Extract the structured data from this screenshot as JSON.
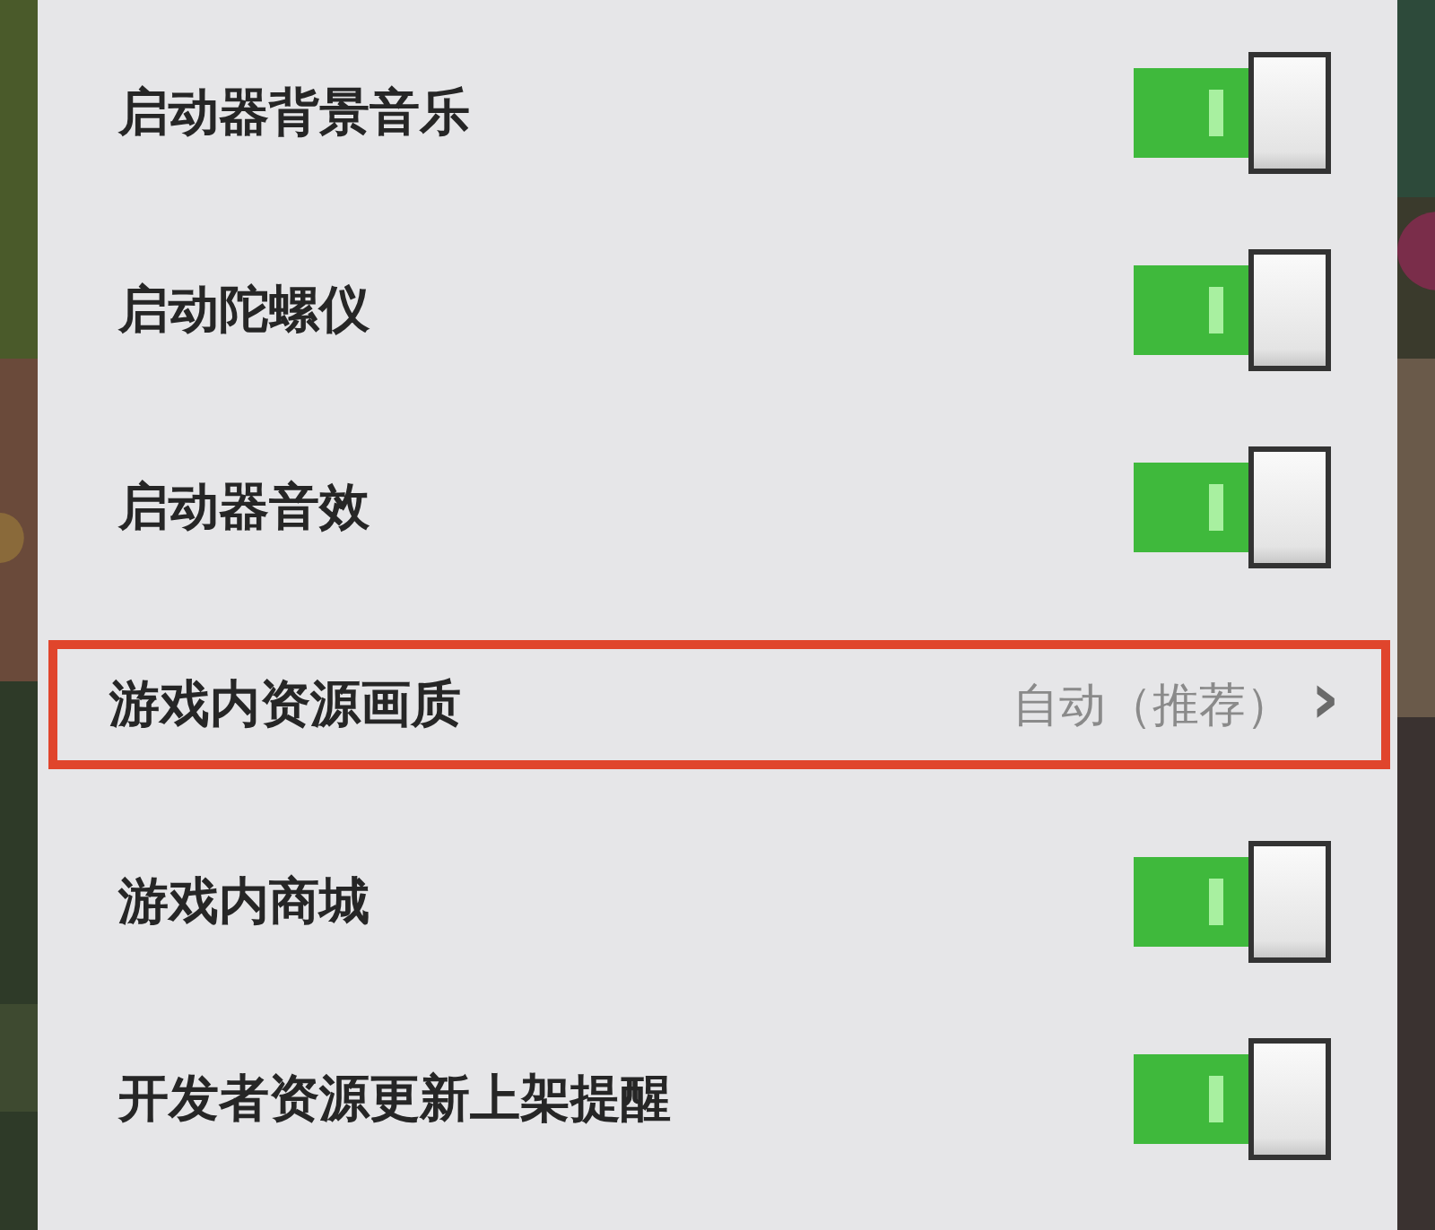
{
  "settings": [
    {
      "kind": "toggle",
      "label": "启动器背景音乐",
      "on": true,
      "highlighted": false
    },
    {
      "kind": "toggle",
      "label": "启动陀螺仪",
      "on": true,
      "highlighted": false
    },
    {
      "kind": "toggle",
      "label": "启动器音效",
      "on": true,
      "highlighted": false
    },
    {
      "kind": "link",
      "label": "游戏内资源画质",
      "value": "自动（推荐）",
      "chevron": "›",
      "highlighted": true
    },
    {
      "kind": "toggle",
      "label": "游戏内商城",
      "on": true,
      "highlighted": false
    },
    {
      "kind": "toggle",
      "label": "开发者资源更新上架提醒",
      "on": true,
      "highlighted": false
    }
  ]
}
